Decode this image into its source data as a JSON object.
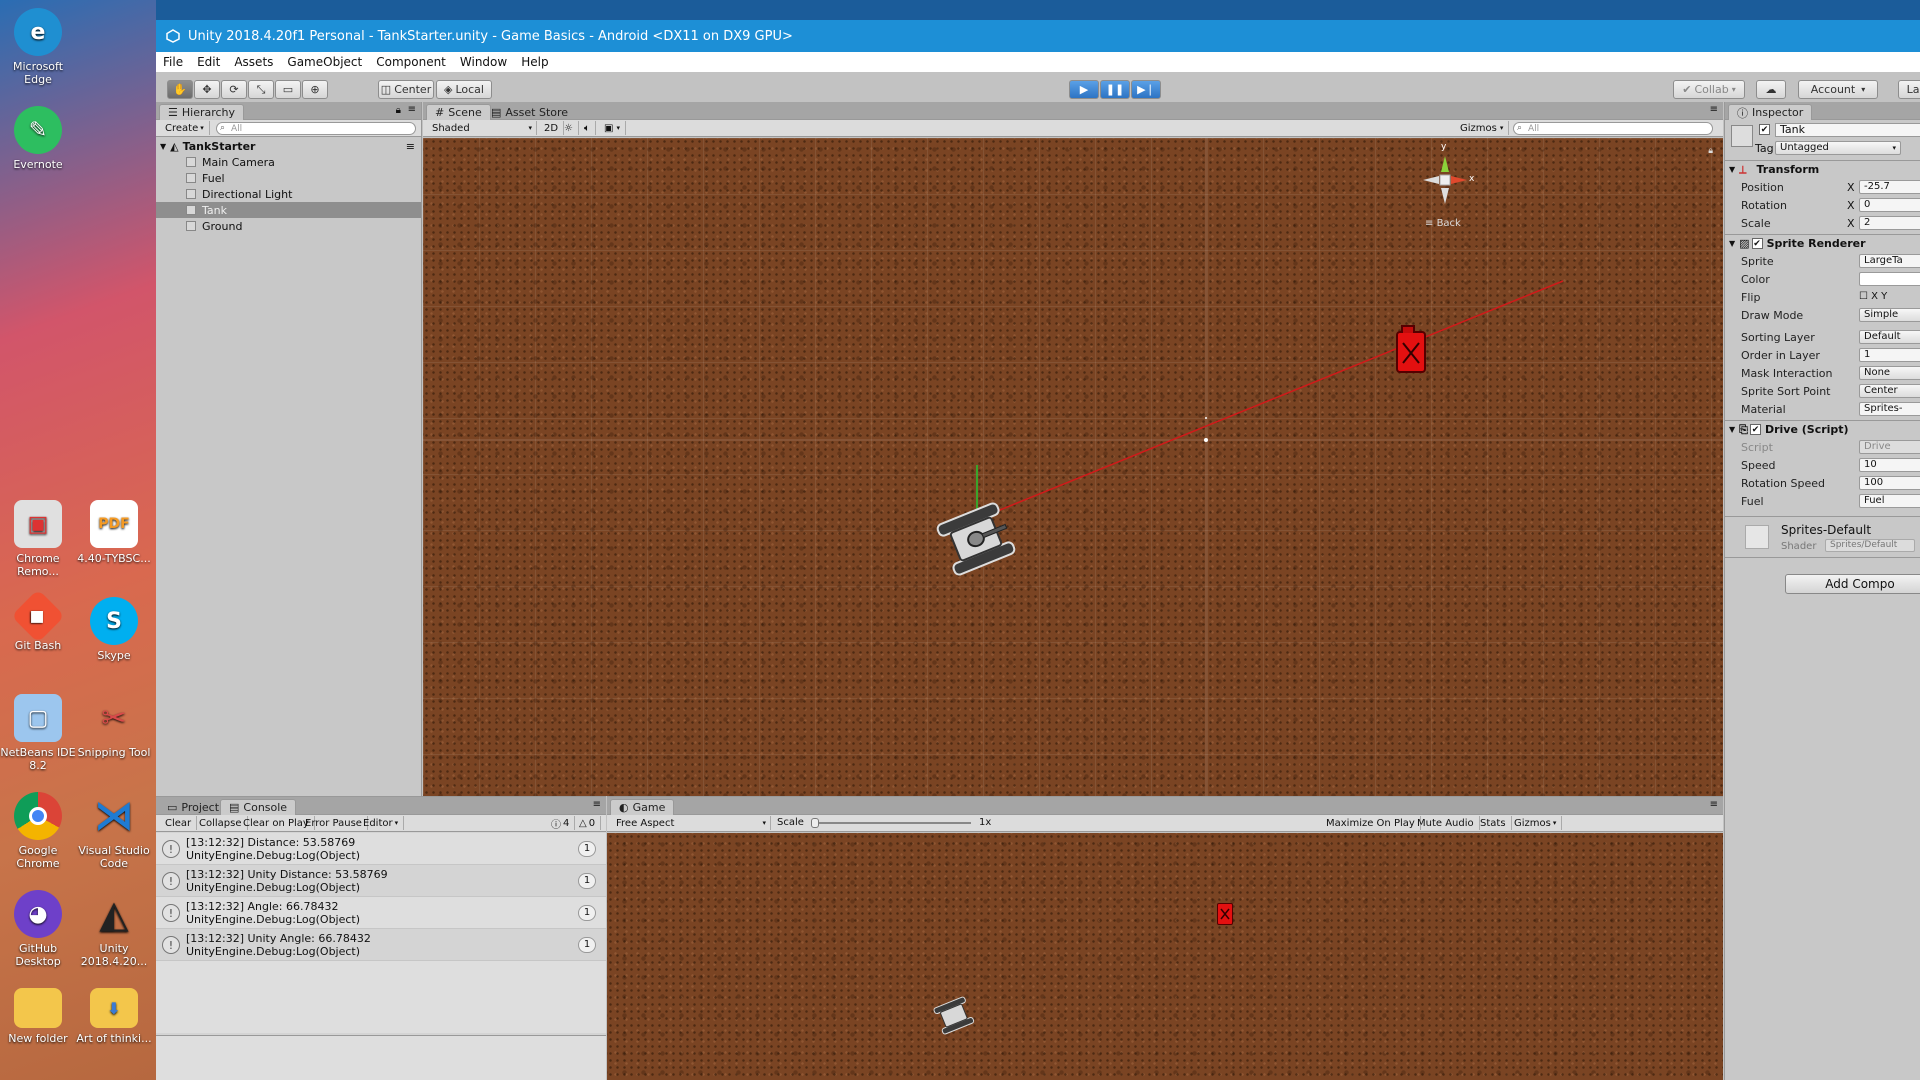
{
  "desktop": {
    "icons": [
      {
        "label": "Microsoft Edge",
        "icon": "edge-icon",
        "color": "#1f8fd1"
      },
      {
        "label": "Evernote",
        "icon": "evernote-icon",
        "color": "#2dbe60"
      },
      {
        "label": "Chrome Remo...",
        "icon": "chrome-remote-icon",
        "color": "#e0e0e0"
      },
      {
        "label": "4.40-TYBSC...",
        "icon": "pdf-icon",
        "color": "#f59a23"
      },
      {
        "label": "Git Bash",
        "icon": "git-icon",
        "color": "#f05133"
      },
      {
        "label": "Skype",
        "icon": "skype-icon",
        "color": "#00aff0"
      },
      {
        "label": "NetBeans IDE 8.2",
        "icon": "netbeans-icon",
        "color": "#9cc6ee"
      },
      {
        "label": "Snipping Tool",
        "icon": "snipping-tool-icon",
        "color": "#d94a4a"
      },
      {
        "label": "Google Chrome",
        "icon": "chrome-icon",
        "color": "#db4437"
      },
      {
        "label": "Visual Studio Code",
        "icon": "vscode-icon",
        "color": "#1f7bd3"
      },
      {
        "label": "GitHub Desktop",
        "icon": "github-icon",
        "color": "#6e40c9"
      },
      {
        "label": "Unity 2018.4.20...",
        "icon": "unity-icon",
        "color": "#222222"
      },
      {
        "label": "New folder",
        "icon": "folder-icon",
        "color": "#f3c64b"
      },
      {
        "label": "Art of thinki...",
        "icon": "file-icon",
        "color": "#f3c64b"
      }
    ]
  },
  "window": {
    "title": "Unity 2018.4.20f1 Personal - TankStarter.unity - Game Basics - Android <DX11 on DX9 GPU>"
  },
  "menu": [
    "File",
    "Edit",
    "Assets",
    "GameObject",
    "Component",
    "Window",
    "Help"
  ],
  "toolbar": {
    "pivot": "Center",
    "space": "Local",
    "collab": "Collab",
    "account": "Account",
    "layers": "La"
  },
  "hierarchy": {
    "tab": "Hierarchy",
    "create": "Create",
    "search_placeholder": "All",
    "scene": "TankStarter",
    "items": [
      "Main Camera",
      "Fuel",
      "Directional Light",
      "Tank",
      "Ground"
    ],
    "selected": "Tank"
  },
  "scene": {
    "tabs": [
      "Scene",
      "Asset Store"
    ],
    "shading": "Shaded",
    "mode_2d": "2D",
    "gizmos": "Gizmos",
    "search_placeholder": "All",
    "view_label": "Back",
    "axis_x": "x",
    "axis_y": "y"
  },
  "console": {
    "tabs": [
      "Project",
      "Console"
    ],
    "buttons": [
      "Clear",
      "Collapse",
      "Clear on Play",
      "Error Pause",
      "Editor"
    ],
    "counts": {
      "info": "4",
      "warning": "0",
      "error": "0"
    },
    "entries": [
      {
        "line1": "[13:12:32] Distance: 53.58769",
        "line2": "UnityEngine.Debug:Log(Object)",
        "count": "1"
      },
      {
        "line1": "[13:12:32] Unity Distance: 53.58769",
        "line2": "UnityEngine.Debug:Log(Object)",
        "count": "1"
      },
      {
        "line1": "[13:12:32] Angle: 66.78432",
        "line2": "UnityEngine.Debug:Log(Object)",
        "count": "1"
      },
      {
        "line1": "[13:12:32] Unity Angle: 66.78432",
        "line2": "UnityEngine.Debug:Log(Object)",
        "count": "1"
      }
    ]
  },
  "game": {
    "tab": "Game",
    "aspect": "Free Aspect",
    "scale_label": "Scale",
    "scale_value": "1x",
    "buttons": [
      "Maximize On Play",
      "Mute Audio",
      "Stats",
      "Gizmos"
    ]
  },
  "inspector": {
    "tab": "Inspector",
    "object_name": "Tank",
    "tag_label": "Tag",
    "tag_value": "Untagged",
    "transform": {
      "title": "Transform",
      "rows": [
        {
          "label": "Position",
          "axis": "X",
          "value": "-25.7"
        },
        {
          "label": "Rotation",
          "axis": "X",
          "value": "0"
        },
        {
          "label": "Scale",
          "axis": "X",
          "value": "2"
        }
      ]
    },
    "sprite_renderer": {
      "title": "Sprite Renderer",
      "rows": [
        {
          "label": "Sprite",
          "value": "LargeTa"
        },
        {
          "label": "Color",
          "value": ""
        },
        {
          "label": "Flip",
          "value": "X   Y"
        },
        {
          "label": "Draw Mode",
          "value": "Simple"
        },
        {
          "label": "Sorting Layer",
          "value": "Default"
        },
        {
          "label": "Order in Layer",
          "value": "1"
        },
        {
          "label": "Mask Interaction",
          "value": "None"
        },
        {
          "label": "Sprite Sort Point",
          "value": "Center"
        },
        {
          "label": "Material",
          "value": "Sprites-"
        }
      ]
    },
    "drive": {
      "title": "Drive (Script)",
      "rows": [
        {
          "label": "Script",
          "value": "Drive"
        },
        {
          "label": "Speed",
          "value": "10"
        },
        {
          "label": "Rotation Speed",
          "value": "100"
        },
        {
          "label": "Fuel",
          "value": "Fuel"
        }
      ]
    },
    "material": {
      "name": "Sprites-Default",
      "shader_label": "Shader",
      "shader_value": "Sprites/Default"
    },
    "add_component": "Add Compo"
  },
  "colors": {
    "titlebar": "#1d8fd6",
    "ground": "#7a4423",
    "fuel": "#e31010",
    "ray": "#d11a1a"
  }
}
